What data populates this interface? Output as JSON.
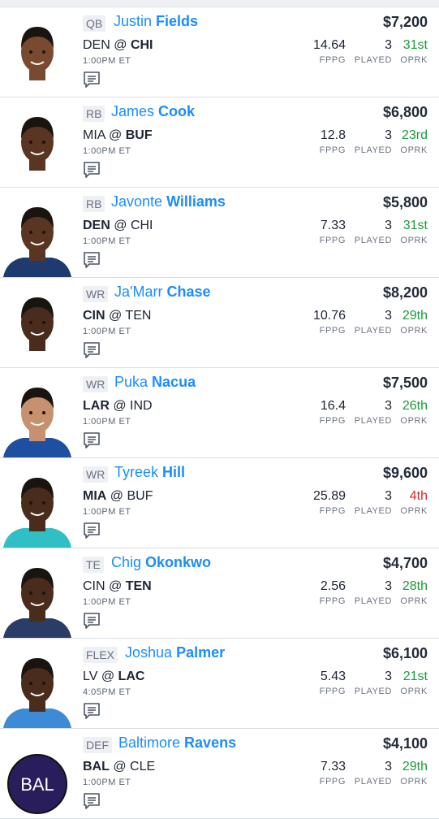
{
  "colors": {
    "accent": "#1a8cff",
    "oprk_good": "#1a9b3a",
    "oprk_bad": "#d52b2b"
  },
  "stat_labels": {
    "fppg": "FPPG",
    "played": "PLAYED",
    "oprk": "OPRK"
  },
  "players": [
    {
      "pos": "QB",
      "first": "Justin",
      "last": "Fields",
      "salary": "$7,200",
      "team": "DEN",
      "sep": "@",
      "opp": "CHI",
      "bold": "opp",
      "time": "1:00PM ET",
      "fppg": "14.64",
      "played": "3",
      "oprk": "31st",
      "oprk_color": "green",
      "skin": "#7a4a30",
      "jersey": "#ffffff"
    },
    {
      "pos": "RB",
      "first": "James",
      "last": "Cook",
      "salary": "$6,800",
      "team": "MIA",
      "sep": "@",
      "opp": "BUF",
      "bold": "opp",
      "time": "1:00PM ET",
      "fppg": "12.8",
      "played": "3",
      "oprk": "23rd",
      "oprk_color": "green",
      "skin": "#5a3522",
      "jersey": "#ffffff"
    },
    {
      "pos": "RB",
      "first": "Javonte",
      "last": "Williams",
      "salary": "$5,800",
      "team": "DEN",
      "sep": "@",
      "opp": "CHI",
      "bold": "team",
      "time": "1:00PM ET",
      "fppg": "7.33",
      "played": "3",
      "oprk": "31st",
      "oprk_color": "green",
      "skin": "#5a3522",
      "jersey": "#1f3a6e"
    },
    {
      "pos": "WR",
      "first": "Ja'Marr",
      "last": "Chase",
      "salary": "$8,200",
      "team": "CIN",
      "sep": "@",
      "opp": "TEN",
      "bold": "team",
      "time": "1:00PM ET",
      "fppg": "10.76",
      "played": "3",
      "oprk": "29th",
      "oprk_color": "green",
      "skin": "#4a2c1c",
      "jersey": "#ffffff"
    },
    {
      "pos": "WR",
      "first": "Puka",
      "last": "Nacua",
      "salary": "$7,500",
      "team": "LAR",
      "sep": "@",
      "opp": "IND",
      "bold": "team",
      "time": "1:00PM ET",
      "fppg": "16.4",
      "played": "3",
      "oprk": "26th",
      "oprk_color": "green",
      "skin": "#c79170",
      "jersey": "#1e4fa0"
    },
    {
      "pos": "WR",
      "first": "Tyreek",
      "last": "Hill",
      "salary": "$9,600",
      "team": "MIA",
      "sep": "@",
      "opp": "BUF",
      "bold": "team",
      "time": "1:00PM ET",
      "fppg": "25.89",
      "played": "3",
      "oprk": "4th",
      "oprk_color": "red",
      "skin": "#4a2c1c",
      "jersey": "#2fbfc4"
    },
    {
      "pos": "TE",
      "first": "Chig",
      "last": "Okonkwo",
      "salary": "$4,700",
      "team": "CIN",
      "sep": "@",
      "opp": "TEN",
      "bold": "opp",
      "time": "1:00PM ET",
      "fppg": "2.56",
      "played": "3",
      "oprk": "28th",
      "oprk_color": "green",
      "skin": "#4a2c1c",
      "jersey": "#2a3d66"
    },
    {
      "pos": "FLEX",
      "first": "Joshua",
      "last": "Palmer",
      "salary": "$6,100",
      "team": "LV",
      "sep": "@",
      "opp": "LAC",
      "bold": "opp",
      "time": "4:05PM ET",
      "fppg": "5.43",
      "played": "3",
      "oprk": "21st",
      "oprk_color": "green",
      "skin": "#4a2c1c",
      "jersey": "#3d8bd6"
    },
    {
      "pos": "DEF",
      "first": "Baltimore",
      "last": "Ravens",
      "salary": "$4,100",
      "team": "BAL",
      "sep": "@",
      "opp": "CLE",
      "bold": "team",
      "time": "1:00PM ET",
      "fppg": "7.33",
      "played": "3",
      "oprk": "29th",
      "oprk_color": "green",
      "logo": "BAL"
    }
  ]
}
